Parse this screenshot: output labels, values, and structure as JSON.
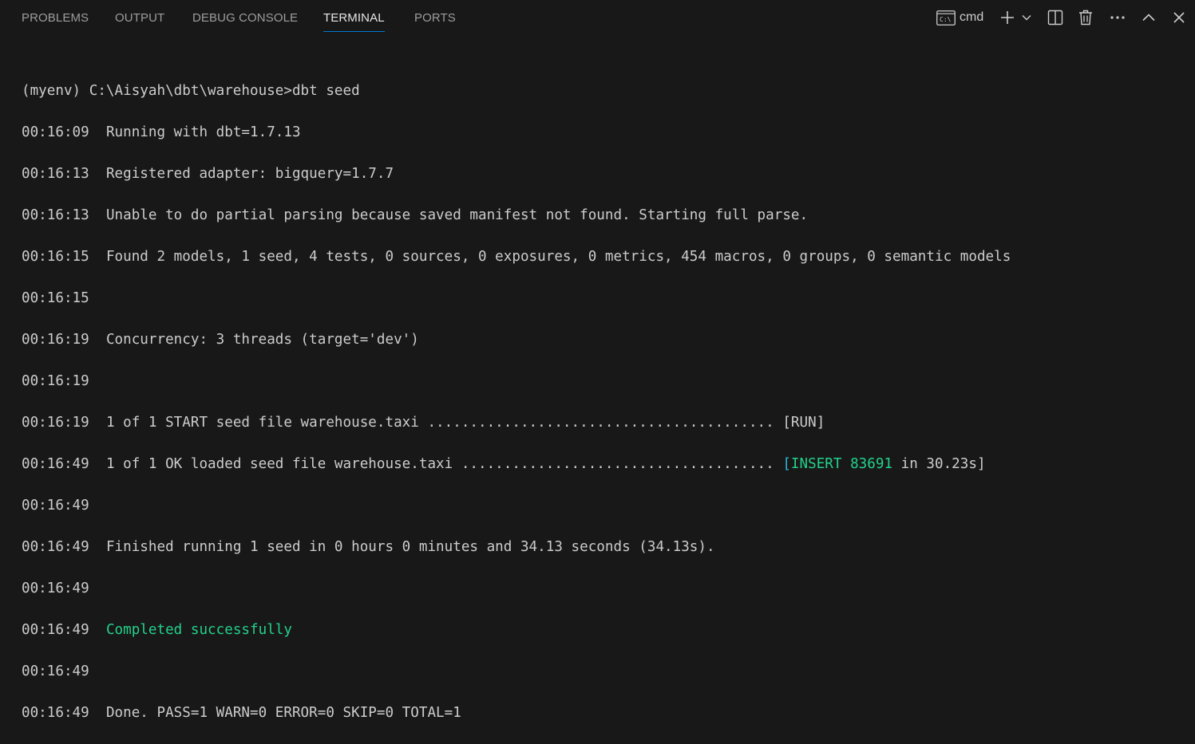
{
  "tabs": [
    {
      "label": "PROBLEMS",
      "active": false
    },
    {
      "label": "OUTPUT",
      "active": false
    },
    {
      "label": "DEBUG CONSOLE",
      "active": false
    },
    {
      "label": "TERMINAL",
      "active": true
    },
    {
      "label": "PORTS",
      "active": false
    }
  ],
  "actions": {
    "shell_icon": "terminal-cmd-icon",
    "shell_label": "cmd",
    "new_terminal_icon": "plus-icon",
    "dropdown_icon": "chevron-down-icon",
    "split_icon": "split-terminal-icon",
    "kill_icon": "trash-icon",
    "more_icon": "ellipsis-icon",
    "maximize_icon": "chevron-up-icon",
    "close_icon": "close-icon"
  },
  "colors": {
    "background": "#181818",
    "text": "#cccccc",
    "accent": "#0078d4",
    "success": "#23d18b",
    "bracket": "#29b8db"
  },
  "terminal": {
    "prompt": "(myenv) C:\\Aisyah\\dbt\\warehouse>dbt seed",
    "lines": [
      {
        "ts": "00:16:09",
        "text": "Running with dbt=1.7.13"
      },
      {
        "ts": "00:16:13",
        "text": "Registered adapter: bigquery=1.7.7"
      },
      {
        "ts": "00:16:13",
        "text": "Unable to do partial parsing because saved manifest not found. Starting full parse."
      },
      {
        "ts": "00:16:15",
        "text": "Found 2 models, 1 seed, 4 tests, 0 sources, 0 exposures, 0 metrics, 454 macros, 0 groups, 0 semantic models"
      },
      {
        "ts": "00:16:15",
        "text": ""
      },
      {
        "ts": "00:16:19",
        "text": "Concurrency: 3 threads (target='dev')"
      },
      {
        "ts": "00:16:19",
        "text": ""
      },
      {
        "ts": "00:16:19",
        "text": "1 of 1 START seed file warehouse.taxi ......................................... [RUN]"
      },
      {
        "ts": "00:16:49",
        "text": "1 of 1 OK loaded seed file warehouse.taxi ..................................... ",
        "bracket_open": "[",
        "status": "INSERT 83691",
        "tail": " in 30.23s]"
      },
      {
        "ts": "00:16:49",
        "text": ""
      },
      {
        "ts": "00:16:49",
        "text": "Finished running 1 seed in 0 hours 0 minutes and 34.13 seconds (34.13s)."
      },
      {
        "ts": "00:16:49",
        "text": ""
      },
      {
        "ts": "00:16:49",
        "text": "",
        "success": "Completed successfully"
      },
      {
        "ts": "00:16:49",
        "text": ""
      },
      {
        "ts": "00:16:49",
        "text": "Done. PASS=1 WARN=0 ERROR=0 SKIP=0 TOTAL=1"
      }
    ]
  }
}
